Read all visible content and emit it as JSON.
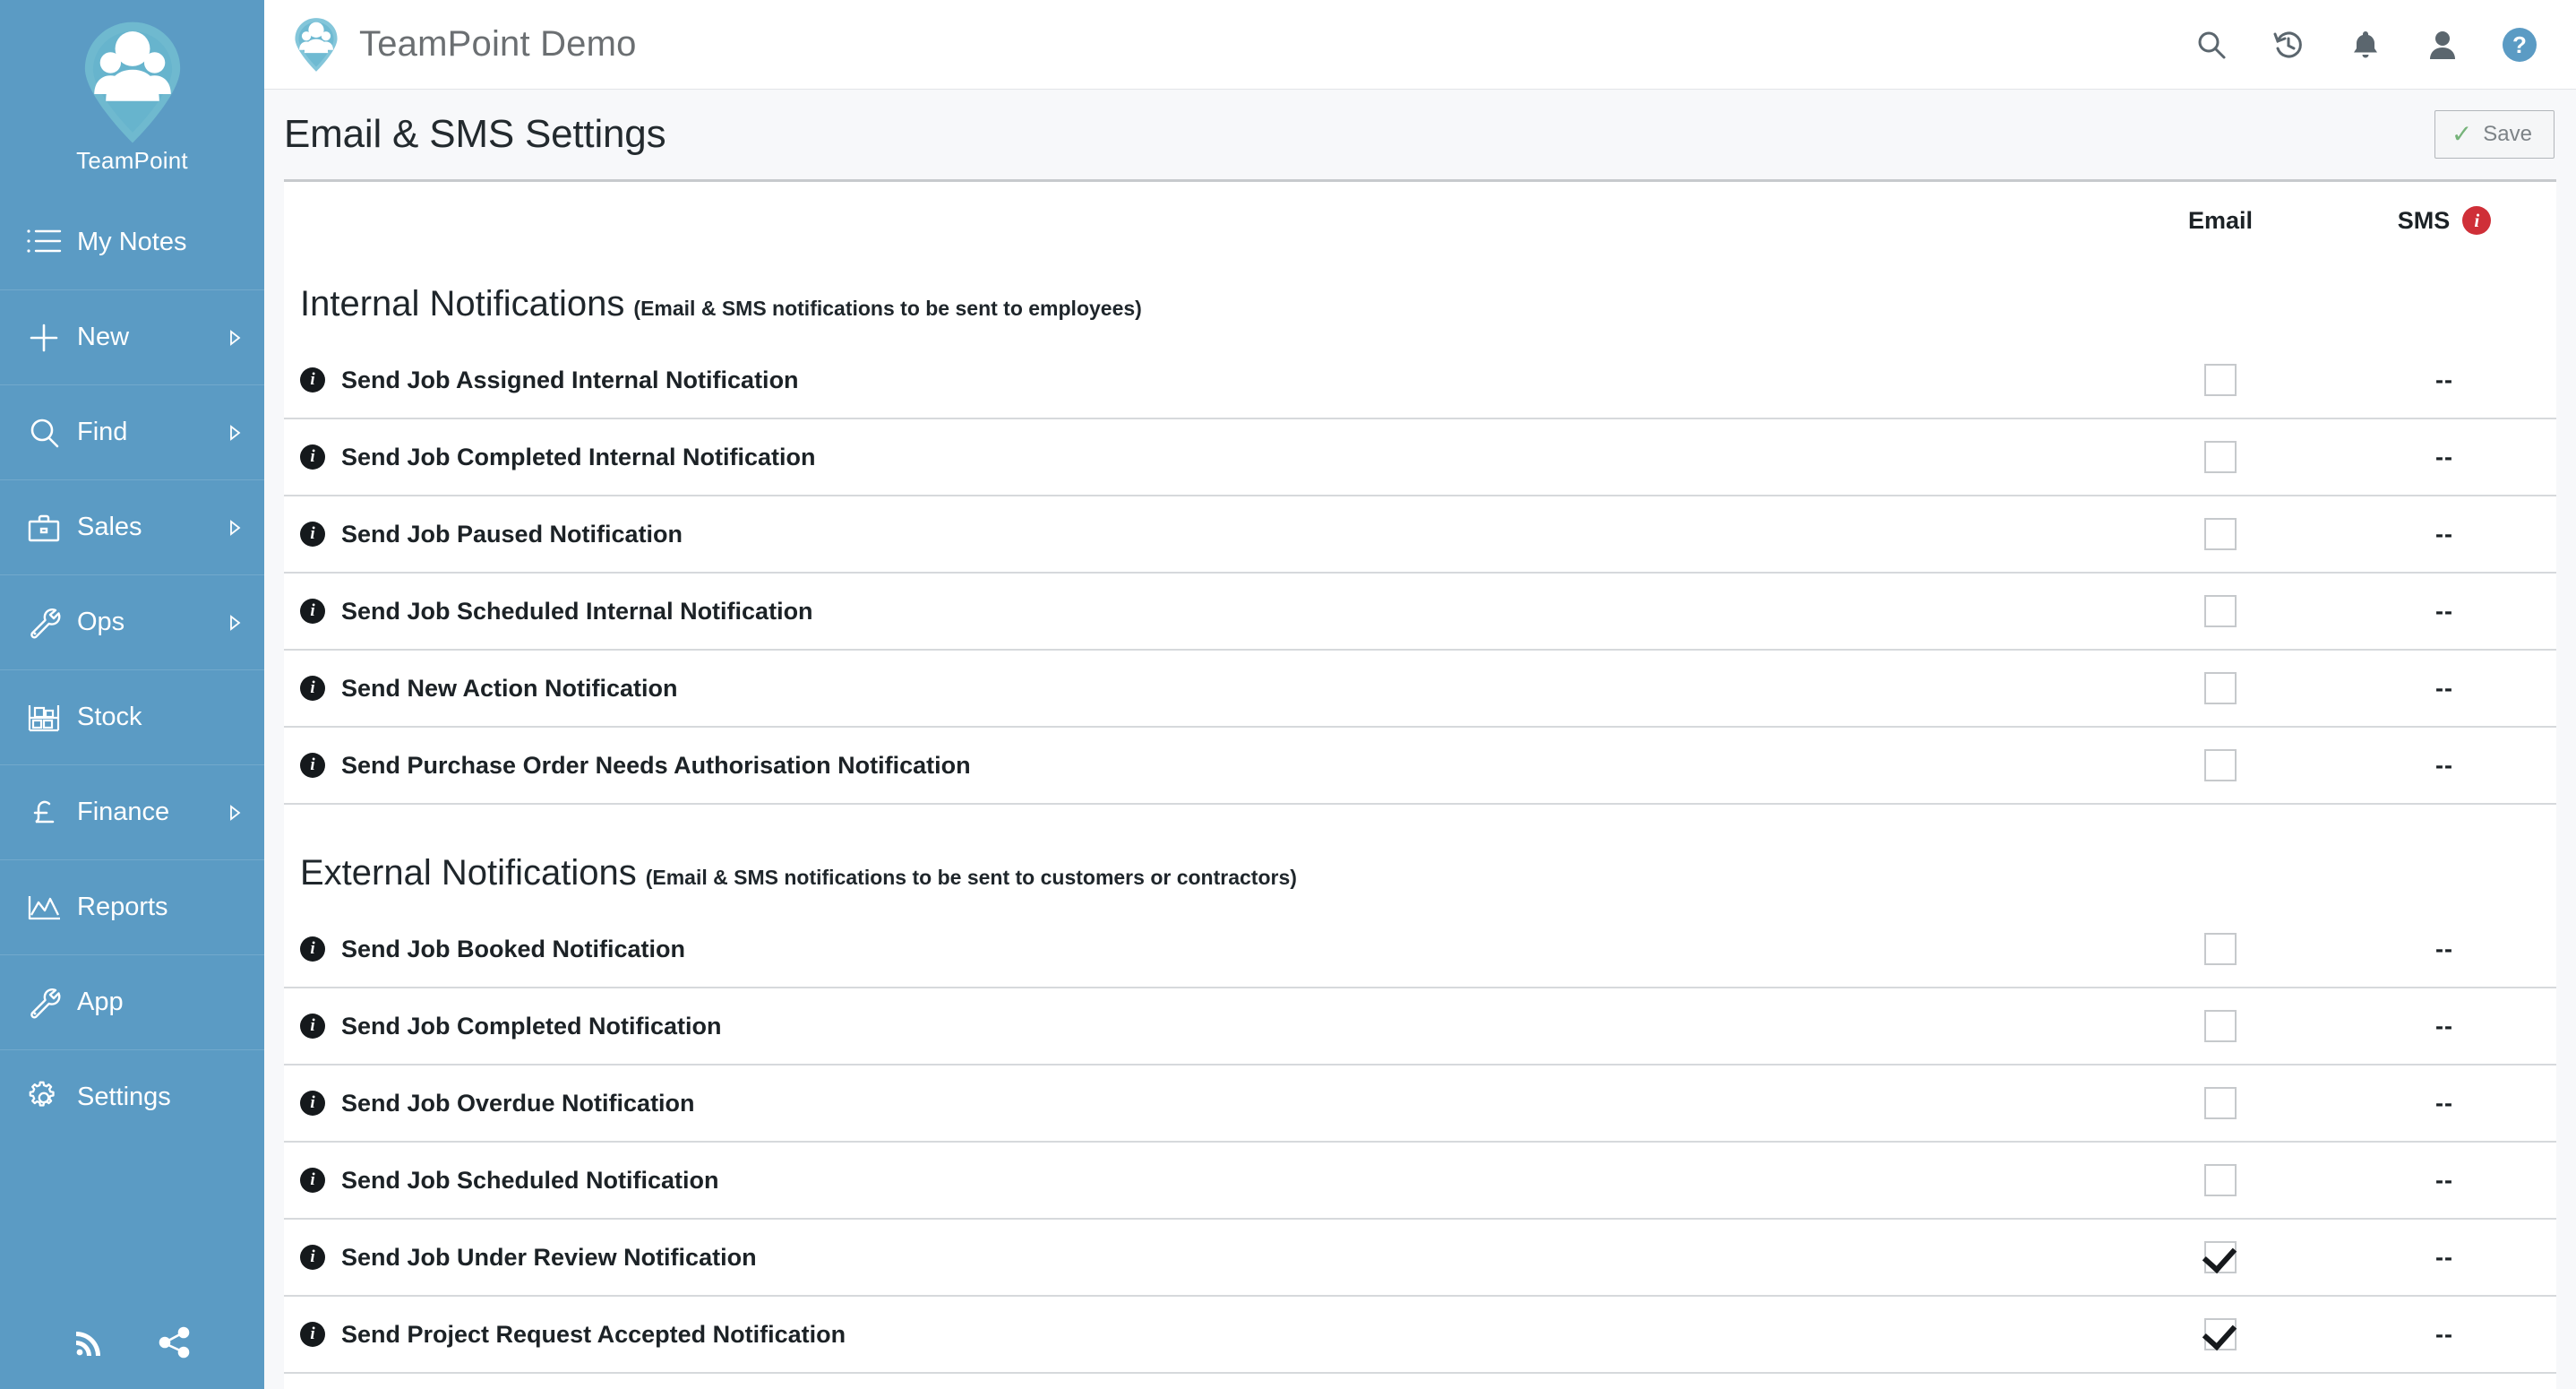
{
  "sidebar": {
    "brand_name": "TeamPoint",
    "items": [
      {
        "label": "My Notes",
        "icon": "list-icon",
        "has_caret": false
      },
      {
        "label": "New",
        "icon": "plus-icon",
        "has_caret": true
      },
      {
        "label": "Find",
        "icon": "search-icon",
        "has_caret": true
      },
      {
        "label": "Sales",
        "icon": "briefcase-icon",
        "has_caret": true
      },
      {
        "label": "Ops",
        "icon": "wrench-icon",
        "has_caret": true
      },
      {
        "label": "Stock",
        "icon": "shelf-icon",
        "has_caret": false
      },
      {
        "label": "Finance",
        "icon": "pound-icon",
        "has_caret": true
      },
      {
        "label": "Reports",
        "icon": "chart-icon",
        "has_caret": false
      },
      {
        "label": "App",
        "icon": "wrench-icon",
        "has_caret": false
      },
      {
        "label": "Settings",
        "icon": "gear-icon",
        "has_caret": false
      }
    ],
    "footer_icons": [
      "rss-icon",
      "share-icon"
    ],
    "background_color": "#5b9bc4"
  },
  "topbar": {
    "title": "TeamPoint Demo",
    "icons": [
      "search-icon",
      "history-icon",
      "bell-icon",
      "user-icon",
      "help-icon"
    ],
    "help_color": "#5b9bc4"
  },
  "page": {
    "title": "Email & SMS Settings",
    "save_label": "Save",
    "save_check_color": "#76b37a"
  },
  "columns": {
    "email": "Email",
    "sms": "SMS",
    "sms_info_icon": "info-icon",
    "sms_info_color": "#cf2f38",
    "empty_value": "--"
  },
  "sections": [
    {
      "title": "Internal Notifications",
      "subtitle": "(Email & SMS notifications to be sent to employees)",
      "rows": [
        {
          "label": "Send Job Assigned Internal Notification",
          "email_checked": false,
          "sms": "--"
        },
        {
          "label": "Send Job Completed Internal Notification",
          "email_checked": false,
          "sms": "--"
        },
        {
          "label": "Send Job Paused Notification",
          "email_checked": false,
          "sms": "--"
        },
        {
          "label": "Send Job Scheduled Internal Notification",
          "email_checked": false,
          "sms": "--"
        },
        {
          "label": "Send New Action Notification",
          "email_checked": false,
          "sms": "--"
        },
        {
          "label": "Send Purchase Order Needs Authorisation Notification",
          "email_checked": false,
          "sms": "--"
        }
      ]
    },
    {
      "title": "External Notifications",
      "subtitle": "(Email & SMS notifications to be sent to customers or contractors)",
      "rows": [
        {
          "label": "Send Job Booked Notification",
          "email_checked": false,
          "sms": "--"
        },
        {
          "label": "Send Job Completed Notification",
          "email_checked": false,
          "sms": "--"
        },
        {
          "label": "Send Job Overdue Notification",
          "email_checked": false,
          "sms": "--"
        },
        {
          "label": "Send Job Scheduled Notification",
          "email_checked": false,
          "sms": "--"
        },
        {
          "label": "Send Job Under Review Notification",
          "email_checked": true,
          "sms": "--"
        },
        {
          "label": "Send Project Request Accepted Notification",
          "email_checked": true,
          "sms": "--"
        }
      ]
    }
  ]
}
